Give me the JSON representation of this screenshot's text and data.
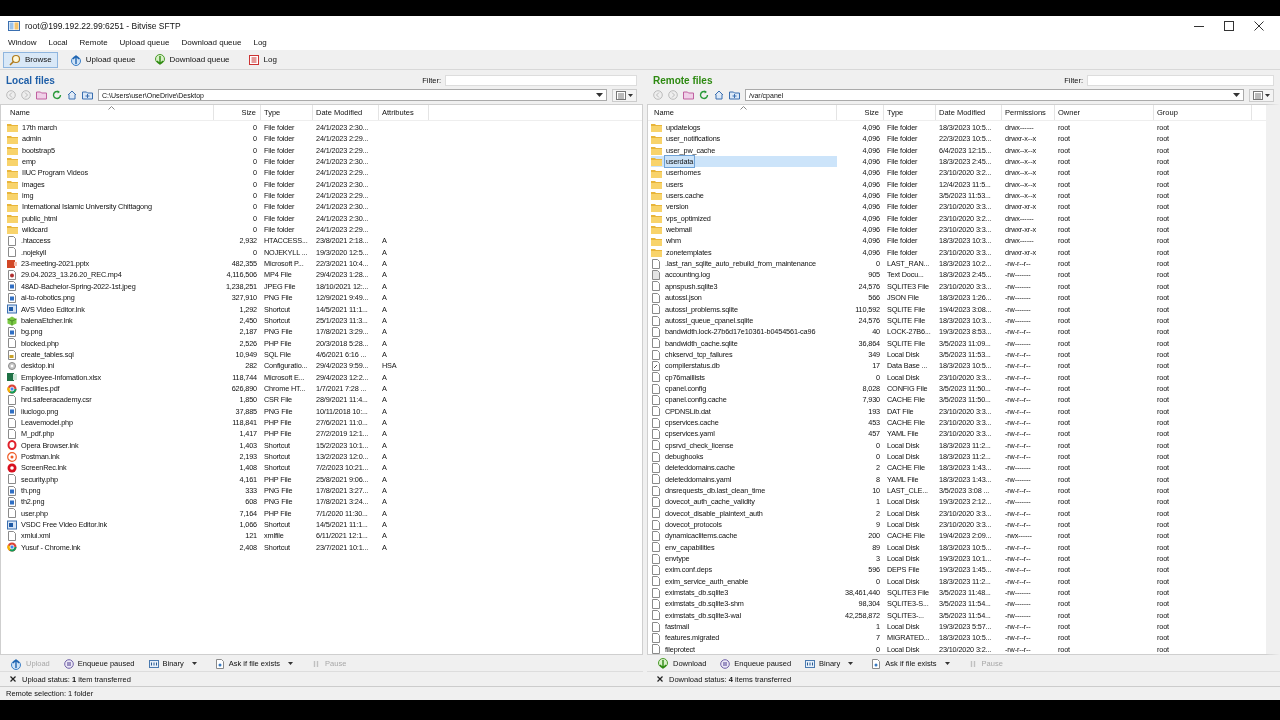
{
  "window": {
    "title": "root@199.192.22.99:6251 - Bitvise SFTP"
  },
  "menu": [
    "Window",
    "Local",
    "Remote",
    "Upload queue",
    "Download queue",
    "Log"
  ],
  "toolbar": [
    {
      "label": "Browse",
      "kind": "browse",
      "selected": true
    },
    {
      "label": "Upload queue",
      "kind": "upload",
      "selected": false
    },
    {
      "label": "Download queue",
      "kind": "download",
      "selected": false
    },
    {
      "label": "Log",
      "kind": "log",
      "selected": false
    }
  ],
  "panes": [
    {
      "kind": "local",
      "title": "Local files",
      "filter_label": "Filter:",
      "path": "C:\\Users\\user\\OneDrive\\Desktop",
      "columns": [
        "Name",
        "Size",
        "Type",
        "Date Modified",
        "Attributes"
      ],
      "rows": [
        {
          "kind": "folder",
          "selected": false,
          "cells": [
            "17th march",
            "0",
            "File folder",
            "24/1/2023 2:30..."
          ]
        },
        {
          "kind": "folder",
          "selected": false,
          "cells": [
            "admin",
            "0",
            "File folder",
            "24/1/2023 2:29..."
          ]
        },
        {
          "kind": "folder",
          "selected": false,
          "cells": [
            "bootstrap5",
            "0",
            "File folder",
            "24/1/2023 2:29..."
          ]
        },
        {
          "kind": "folder",
          "selected": false,
          "cells": [
            "emp",
            "0",
            "File folder",
            "24/1/2023 2:30..."
          ]
        },
        {
          "kind": "folder",
          "selected": false,
          "cells": [
            "IIUC Program Videos",
            "0",
            "File folder",
            "24/1/2023 2:29..."
          ]
        },
        {
          "kind": "folder",
          "selected": false,
          "cells": [
            "images",
            "0",
            "File folder",
            "24/1/2023 2:30..."
          ]
        },
        {
          "kind": "folder",
          "selected": false,
          "cells": [
            "img",
            "0",
            "File folder",
            "24/1/2023 2:29..."
          ]
        },
        {
          "kind": "folder",
          "selected": false,
          "cells": [
            "International Islamic University Chittagong",
            "0",
            "File folder",
            "24/1/2023 2:30..."
          ]
        },
        {
          "kind": "folder",
          "selected": false,
          "cells": [
            "public_html",
            "0",
            "File folder",
            "24/1/2023 2:30..."
          ]
        },
        {
          "kind": "folder",
          "selected": false,
          "cells": [
            "wildcard",
            "0",
            "File folder",
            "24/1/2023 2:29..."
          ]
        },
        {
          "kind": "file",
          "selected": false,
          "cells": [
            ".htaccess",
            "2,932",
            "HTACCESS...",
            "23/8/2021 2:18...",
            "A"
          ]
        },
        {
          "kind": "file",
          "selected": false,
          "cells": [
            ".nojekyll",
            "0",
            "NOJEKYLL ...",
            "19/3/2020 12:5...",
            "A"
          ]
        },
        {
          "kind": "slides",
          "selected": false,
          "cells": [
            "23-meeting-2021.pptx",
            "482,355",
            "Microsoft P...",
            "22/3/2021 10:4...",
            "A"
          ]
        },
        {
          "kind": "video",
          "selected": false,
          "cells": [
            "29.04.2023_13.26.20_REC.mp4",
            "4,116,506",
            "MP4 File",
            "29/4/2023 1:28...",
            "A"
          ]
        },
        {
          "kind": "image",
          "selected": false,
          "cells": [
            "48AD-Bachelor-Spring-2022-1st.jpeg",
            "1,238,251",
            "JPEG File",
            "18/10/2021 12:...",
            "A"
          ]
        },
        {
          "kind": "image",
          "selected": false,
          "cells": [
            "ai-to-robotics.png",
            "327,910",
            "PNG File",
            "12/9/2021 9:49...",
            "A"
          ]
        },
        {
          "kind": "app",
          "selected": false,
          "cells": [
            "AVS Video Editor.lnk",
            "1,292",
            "Shortcut",
            "14/5/2021 11:1...",
            "A"
          ]
        },
        {
          "kind": "cube",
          "selected": false,
          "cells": [
            "balenaEtcher.lnk",
            "2,450",
            "Shortcut",
            "25/1/2023 11:3...",
            "A"
          ]
        },
        {
          "kind": "image",
          "selected": false,
          "cells": [
            "bg.png",
            "2,187",
            "PNG File",
            "17/8/2021 3:29...",
            "A"
          ]
        },
        {
          "kind": "file",
          "selected": false,
          "cells": [
            "blocked.php",
            "2,526",
            "PHP File",
            "20/3/2018 5:28...",
            "A"
          ]
        },
        {
          "kind": "sql",
          "selected": false,
          "cells": [
            "create_tables.sql",
            "10,949",
            "SQL File",
            "4/6/2021 6:16 ...",
            "A"
          ]
        },
        {
          "kind": "settings",
          "selected": false,
          "cells": [
            "desktop.ini",
            "282",
            "Configuratio...",
            "29/4/2023 9:59...",
            "HSA"
          ]
        },
        {
          "kind": "sheet",
          "selected": false,
          "cells": [
            "Employee-Infomation.xlsx",
            "118,744",
            "Microsoft E...",
            "29/4/2023 12:2...",
            "A"
          ]
        },
        {
          "kind": "browser",
          "selected": false,
          "cells": [
            "Facilities.pdf",
            "626,890",
            "Chrome HT...",
            "1/7/2021 7:28 ...",
            "A"
          ]
        },
        {
          "kind": "file",
          "selected": false,
          "cells": [
            "hrd.safeeracademy.csr",
            "1,850",
            "CSR File",
            "28/9/2021 11:4...",
            "A"
          ]
        },
        {
          "kind": "image",
          "selected": false,
          "cells": [
            "iiuclogo.png",
            "37,885",
            "PNG File",
            "10/11/2018 10:...",
            "A"
          ]
        },
        {
          "kind": "file",
          "selected": false,
          "cells": [
            "Leavemodel.php",
            "118,841",
            "PHP File",
            "27/6/2021 11:0...",
            "A"
          ]
        },
        {
          "kind": "file",
          "selected": false,
          "cells": [
            "M_pdf.php",
            "1,417",
            "PHP File",
            "27/2/2019 12:1...",
            "A"
          ]
        },
        {
          "kind": "ring",
          "selected": false,
          "cells": [
            "Opera Browser.lnk",
            "1,403",
            "Shortcut",
            "15/2/2023 10:1...",
            "A"
          ]
        },
        {
          "kind": "orb",
          "selected": false,
          "cells": [
            "Postman.lnk",
            "2,193",
            "Shortcut",
            "13/2/2023 12:0...",
            "A"
          ]
        },
        {
          "kind": "record",
          "selected": false,
          "cells": [
            "ScreenRec.lnk",
            "1,408",
            "Shortcut",
            "7/2/2023 10:21...",
            "A"
          ]
        },
        {
          "kind": "file",
          "selected": false,
          "cells": [
            "security.php",
            "4,161",
            "PHP File",
            "25/8/2021 9:06...",
            "A"
          ]
        },
        {
          "kind": "image",
          "selected": false,
          "cells": [
            "th.png",
            "333",
            "PNG File",
            "17/8/2021 3:27...",
            "A"
          ]
        },
        {
          "kind": "image",
          "selected": false,
          "cells": [
            "th2.png",
            "608",
            "PNG File",
            "17/8/2021 3:24...",
            "A"
          ]
        },
        {
          "kind": "file",
          "selected": false,
          "cells": [
            "user.php",
            "7,164",
            "PHP File",
            "7/1/2020 11:30...",
            "A"
          ]
        },
        {
          "kind": "app",
          "selected": false,
          "cells": [
            "VSDC Free Video Editor.lnk",
            "1,066",
            "Shortcut",
            "14/5/2021 11:1...",
            "A"
          ]
        },
        {
          "kind": "file",
          "selected": false,
          "cells": [
            "xmlui.xml",
            "121",
            "xmlfile",
            "6/11/2021 12:1...",
            "A"
          ]
        },
        {
          "kind": "browser",
          "selected": false,
          "cells": [
            "Yusuf - Chrome.lnk",
            "2,408",
            "Shortcut",
            "23/7/2021 10:1...",
            "A"
          ]
        }
      ],
      "actions": [
        {
          "label": "Upload",
          "kind": "upload",
          "disabled": true,
          "dropdown": false
        },
        {
          "label": "Enqueue paused",
          "kind": "pause",
          "disabled": false,
          "dropdown": false
        },
        {
          "label": "Binary",
          "kind": "binary",
          "disabled": false,
          "dropdown": true
        },
        {
          "label": "Ask if file exists",
          "kind": "ask",
          "disabled": false,
          "dropdown": true
        },
        {
          "label": "Pause",
          "kind": "pause-bars",
          "disabled": true,
          "dropdown": false
        }
      ],
      "status": "Upload status: **1** item transferred"
    },
    {
      "kind": "remote",
      "title": "Remote files",
      "filter_label": "Filter:",
      "path": "/var/cpanel",
      "columns": [
        "Name",
        "Size",
        "Type",
        "Date Modified",
        "Permissions",
        "Owner",
        "Group"
      ],
      "rows": [
        {
          "kind": "folder",
          "selected": false,
          "cells": [
            "updatelogs",
            "4,096",
            "File folder",
            "18/3/2023 10:5...",
            "drwx------",
            "root",
            "root"
          ]
        },
        {
          "kind": "folder",
          "selected": false,
          "cells": [
            "user_notifications",
            "4,096",
            "File folder",
            "22/3/2023 10:5...",
            "drwxr-x--x",
            "root",
            "root"
          ]
        },
        {
          "kind": "folder",
          "selected": false,
          "cells": [
            "user_pw_cache",
            "4,096",
            "File folder",
            "6/4/2023 12:15...",
            "drwx--x--x",
            "root",
            "root"
          ]
        },
        {
          "kind": "folder",
          "selected": true,
          "cells": [
            "userdata",
            "4,096",
            "File folder",
            "18/3/2023 2:45...",
            "drwx--x--x",
            "root",
            "root"
          ]
        },
        {
          "kind": "folder",
          "selected": false,
          "cells": [
            "userhomes",
            "4,096",
            "File folder",
            "23/10/2020 3:2...",
            "drwx--x--x",
            "root",
            "root"
          ]
        },
        {
          "kind": "folder",
          "selected": false,
          "cells": [
            "users",
            "4,096",
            "File folder",
            "12/4/2023 11:5...",
            "drwx--x--x",
            "root",
            "root"
          ]
        },
        {
          "kind": "folder",
          "selected": false,
          "cells": [
            "users.cache",
            "4,096",
            "File folder",
            "3/5/2023 11:53...",
            "drwx--x--x",
            "root",
            "root"
          ]
        },
        {
          "kind": "folder",
          "selected": false,
          "cells": [
            "version",
            "4,096",
            "File folder",
            "23/10/2020 3:3...",
            "drwxr-xr-x",
            "root",
            "root"
          ]
        },
        {
          "kind": "folder",
          "selected": false,
          "cells": [
            "vps_optimized",
            "4,096",
            "File folder",
            "23/10/2020 3:2...",
            "drwx------",
            "root",
            "root"
          ]
        },
        {
          "kind": "folder",
          "selected": false,
          "cells": [
            "webmail",
            "4,096",
            "File folder",
            "23/10/2020 3:3...",
            "drwxr-xr-x",
            "root",
            "root"
          ]
        },
        {
          "kind": "folder",
          "selected": false,
          "cells": [
            "whm",
            "4,096",
            "File folder",
            "18/3/2023 10:3...",
            "drwx------",
            "root",
            "root"
          ]
        },
        {
          "kind": "folder",
          "selected": false,
          "cells": [
            "zonetemplates",
            "4,096",
            "File folder",
            "23/10/2020 3:3...",
            "drwxr-xr-x",
            "root",
            "root"
          ]
        },
        {
          "kind": "file",
          "selected": false,
          "cells": [
            ".last_ran_sqlite_auto_rebuild_from_maintenance",
            "0",
            "LAST_RAN...",
            "18/3/2023 10:2...",
            "-rw-r--r--",
            "root",
            "root"
          ]
        },
        {
          "kind": "text",
          "selected": false,
          "cells": [
            "accounting.log",
            "905",
            "Text Docu...",
            "18/3/2023 2:45...",
            "-rw-------",
            "root",
            "root"
          ]
        },
        {
          "kind": "file",
          "selected": false,
          "cells": [
            "apnspush.sqlite3",
            "24,576",
            "SQLITE3 File",
            "23/10/2020 3:3...",
            "-rw-------",
            "root",
            "root"
          ]
        },
        {
          "kind": "file",
          "selected": false,
          "cells": [
            "autossl.json",
            "566",
            "JSON File",
            "18/3/2023 1:26...",
            "-rw-------",
            "root",
            "root"
          ]
        },
        {
          "kind": "file",
          "selected": false,
          "cells": [
            "autossl_problems.sqlite",
            "110,592",
            "SQLITE File",
            "19/4/2023 3:08...",
            "-rw-------",
            "root",
            "root"
          ]
        },
        {
          "kind": "file",
          "selected": false,
          "cells": [
            "autossl_queue_cpanel.sqlite",
            "24,576",
            "SQLITE File",
            "18/3/2023 10:3...",
            "-rw-------",
            "root",
            "root"
          ]
        },
        {
          "kind": "file",
          "selected": false,
          "cells": [
            "bandwidth.lock-27b6d17e10361-b0454561-ca96",
            "40",
            "LOCK-27B6...",
            "19/3/2023 8:53...",
            "-rw-r--r--",
            "root",
            "root"
          ]
        },
        {
          "kind": "file",
          "selected": false,
          "cells": [
            "bandwidth_cache.sqlite",
            "36,864",
            "SQLITE File",
            "3/5/2023 11:09...",
            "-rw-------",
            "root",
            "root"
          ]
        },
        {
          "kind": "file",
          "selected": false,
          "cells": [
            "chkservd_tcp_failures",
            "349",
            "Local Disk",
            "3/5/2023 11:53...",
            "-rw-r--r--",
            "root",
            "root"
          ]
        },
        {
          "kind": "database",
          "selected": false,
          "cells": [
            "compilerstatus.db",
            "17",
            "Data Base ...",
            "18/3/2023 10:5...",
            "-rw-r--r--",
            "root",
            "root"
          ]
        },
        {
          "kind": "file",
          "selected": false,
          "cells": [
            "cp76maillists",
            "0",
            "Local Disk",
            "23/10/2020 3:3...",
            "-rw-r--r--",
            "root",
            "root"
          ]
        },
        {
          "kind": "file",
          "selected": false,
          "cells": [
            "cpanel.config",
            "8,028",
            "CONFIG File",
            "3/5/2023 11:50...",
            "-rw-r--r--",
            "root",
            "root"
          ]
        },
        {
          "kind": "file",
          "selected": false,
          "cells": [
            "cpanel.config.cache",
            "7,930",
            "CACHE File",
            "3/5/2023 11:50...",
            "-rw-r--r--",
            "root",
            "root"
          ]
        },
        {
          "kind": "file",
          "selected": false,
          "cells": [
            "CPDNSLib.dat",
            "193",
            "DAT File",
            "23/10/2020 3:3...",
            "-rw-r--r--",
            "root",
            "root"
          ]
        },
        {
          "kind": "file",
          "selected": false,
          "cells": [
            "cpservices.cache",
            "453",
            "CACHE File",
            "23/10/2020 3:3...",
            "-rw-r--r--",
            "root",
            "root"
          ]
        },
        {
          "kind": "file",
          "selected": false,
          "cells": [
            "cpservices.yaml",
            "457",
            "YAML File",
            "23/10/2020 3:3...",
            "-rw-r--r--",
            "root",
            "root"
          ]
        },
        {
          "kind": "file",
          "selected": false,
          "cells": [
            "cpsrvd_check_license",
            "0",
            "Local Disk",
            "18/3/2023 11:2...",
            "-rw-r--r--",
            "root",
            "root"
          ]
        },
        {
          "kind": "file",
          "selected": false,
          "cells": [
            "debughooks",
            "0",
            "Local Disk",
            "18/3/2023 11:2...",
            "-rw-r--r--",
            "root",
            "root"
          ]
        },
        {
          "kind": "file",
          "selected": false,
          "cells": [
            "deleteddomains.cache",
            "2",
            "CACHE File",
            "18/3/2023 1:43...",
            "-rw-------",
            "root",
            "root"
          ]
        },
        {
          "kind": "file",
          "selected": false,
          "cells": [
            "deleteddomains.yaml",
            "8",
            "YAML File",
            "18/3/2023 1:43...",
            "-rw-------",
            "root",
            "root"
          ]
        },
        {
          "kind": "file",
          "selected": false,
          "cells": [
            "dnsrequests_db.last_clean_time",
            "10",
            "LAST_CLE...",
            "3/5/2023 3:08 ...",
            "-rw-r--r--",
            "root",
            "root"
          ]
        },
        {
          "kind": "file",
          "selected": false,
          "cells": [
            "dovecot_auth_cache_validity",
            "1",
            "Local Disk",
            "19/3/2023 2:12...",
            "-rw-------",
            "root",
            "root"
          ]
        },
        {
          "kind": "file",
          "selected": false,
          "cells": [
            "dovecot_disable_plaintext_auth",
            "2",
            "Local Disk",
            "23/10/2020 3:3...",
            "-rw-r--r--",
            "root",
            "root"
          ]
        },
        {
          "kind": "file",
          "selected": false,
          "cells": [
            "dovecot_protocols",
            "9",
            "Local Disk",
            "23/10/2020 3:3...",
            "-rw-r--r--",
            "root",
            "root"
          ]
        },
        {
          "kind": "file",
          "selected": false,
          "cells": [
            "dynamicaclitems.cache",
            "200",
            "CACHE File",
            "19/4/2023 2:09...",
            "-rwx------",
            "root",
            "root"
          ]
        },
        {
          "kind": "file",
          "selected": false,
          "cells": [
            "env_capabilities",
            "89",
            "Local Disk",
            "18/3/2023 10:5...",
            "-rw-r--r--",
            "root",
            "root"
          ]
        },
        {
          "kind": "file",
          "selected": false,
          "cells": [
            "envtype",
            "3",
            "Local Disk",
            "19/3/2023 10:1...",
            "-rw-r--r--",
            "root",
            "root"
          ]
        },
        {
          "kind": "file",
          "selected": false,
          "cells": [
            "exim.conf.deps",
            "596",
            "DEPS File",
            "19/3/2023 1:45...",
            "-rw-r--r--",
            "root",
            "root"
          ]
        },
        {
          "kind": "file",
          "selected": false,
          "cells": [
            "exim_service_auth_enable",
            "0",
            "Local Disk",
            "18/3/2023 11:2...",
            "-rw-r--r--",
            "root",
            "root"
          ]
        },
        {
          "kind": "file",
          "selected": false,
          "cells": [
            "eximstats_db.sqlite3",
            "38,461,440",
            "SQLITE3 File",
            "3/5/2023 11:48...",
            "-rw-------",
            "root",
            "root"
          ]
        },
        {
          "kind": "file",
          "selected": false,
          "cells": [
            "eximstats_db.sqlite3-shm",
            "98,304",
            "SQLITE3-S...",
            "3/5/2023 11:54...",
            "-rw-------",
            "root",
            "root"
          ]
        },
        {
          "kind": "file",
          "selected": false,
          "cells": [
            "eximstats_db.sqlite3-wal",
            "42,258,872",
            "SQLITE3-...",
            "3/5/2023 11:54...",
            "-rw-------",
            "root",
            "root"
          ]
        },
        {
          "kind": "file",
          "selected": false,
          "cells": [
            "fastmail",
            "1",
            "Local Disk",
            "19/3/2023 5:57...",
            "-rw-r--r--",
            "root",
            "root"
          ]
        },
        {
          "kind": "file",
          "selected": false,
          "cells": [
            "features.migrated",
            "7",
            "MIGRATED...",
            "18/3/2023 10:5...",
            "-rw-r--r--",
            "root",
            "root"
          ]
        },
        {
          "kind": "file",
          "selected": false,
          "cells": [
            "fileprotect",
            "0",
            "Local Disk",
            "23/10/2020 3:2...",
            "-rw-r--r--",
            "root",
            "root"
          ]
        }
      ],
      "actions": [
        {
          "label": "Download",
          "kind": "download",
          "disabled": false,
          "dropdown": false
        },
        {
          "label": "Enqueue paused",
          "kind": "pause",
          "disabled": false,
          "dropdown": false
        },
        {
          "label": "Binary",
          "kind": "binary",
          "disabled": false,
          "dropdown": true
        },
        {
          "label": "Ask if file exists",
          "kind": "ask",
          "disabled": false,
          "dropdown": true
        },
        {
          "label": "Pause",
          "kind": "pause-bars",
          "disabled": true,
          "dropdown": false
        }
      ],
      "status": "Download status: **4** items transferred"
    }
  ],
  "status_bar": "Remote selection: 1 folder"
}
